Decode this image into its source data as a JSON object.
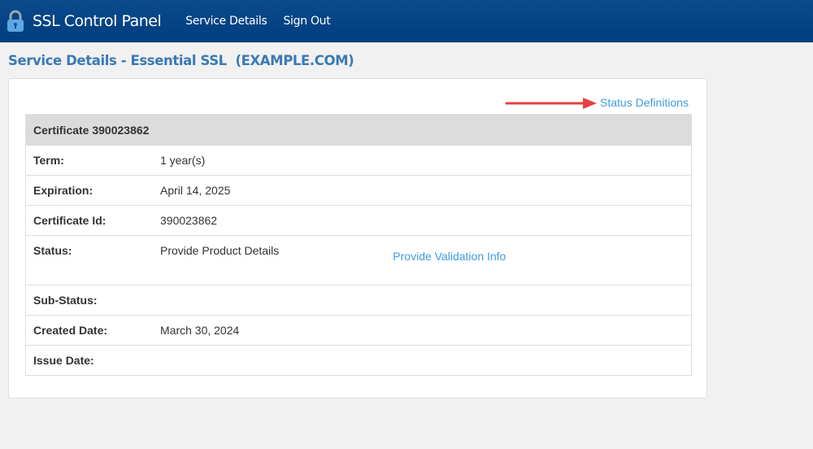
{
  "nav": {
    "brand": "SSL Control Panel",
    "links": [
      "Service Details",
      "Sign Out"
    ]
  },
  "title": "Service Details - Essential SSL  (EXAMPLE.COM)",
  "status_definitions": "Status Definitions",
  "certificate": {
    "header": "Certificate 390023862",
    "rows": [
      {
        "label": "Term:",
        "value": "1 year(s)"
      },
      {
        "label": "Expiration:",
        "value": "April 14, 2025"
      },
      {
        "label": "Certificate Id:",
        "value": "390023862"
      },
      {
        "label": "Status:",
        "value": "Provide Product Details",
        "link": "Provide Validation Info"
      },
      {
        "label": "Sub-Status:",
        "value": ""
      },
      {
        "label": "Created Date:",
        "value": "March 30, 2024"
      },
      {
        "label": "Issue Date:",
        "value": ""
      }
    ]
  }
}
